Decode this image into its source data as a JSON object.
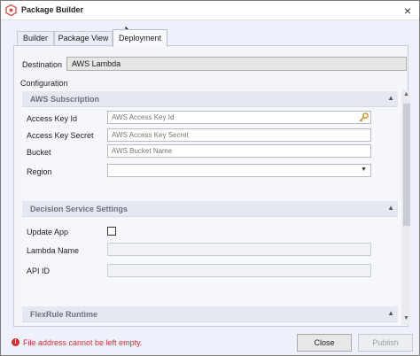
{
  "window": {
    "title": "Package Builder",
    "close_glyph": "×"
  },
  "tabs": [
    {
      "label": "Builder",
      "active": false
    },
    {
      "label": "Package View",
      "active": false
    },
    {
      "label": "Deployment",
      "active": true
    }
  ],
  "destination": {
    "label": "Destination",
    "value": "AWS Lambda",
    "chevron": "⌵"
  },
  "configuration": {
    "label": "Configuration",
    "sections": [
      {
        "title": "AWS Subscription",
        "fields": [
          {
            "label": "Access Key Id",
            "placeholder": "AWS Access Key Id"
          },
          {
            "label": "Access Key Secret",
            "placeholder": "AWS Access Key Secret"
          },
          {
            "label": "Bucket",
            "placeholder": "AWS Bucket Name"
          },
          {
            "label": "Region",
            "placeholder": ""
          }
        ]
      },
      {
        "title": "Decision Service Settings",
        "fields": [
          {
            "label": "Update App"
          },
          {
            "label": "Lambda Name"
          },
          {
            "label": "API ID"
          }
        ]
      },
      {
        "title": "FlexRule Runtime"
      }
    ],
    "collapse_glyph": "▲",
    "select_chevron": "▼"
  },
  "footer": {
    "error_text": "File address cannot be left empty.",
    "error_glyph": "!",
    "close_label": "Close",
    "publish_label": "Publish"
  },
  "colors": {
    "error": "#d0312d",
    "panel": "#f3f5fb",
    "window_bg": "#eef1fb"
  },
  "icons": [
    "app-logo-icon",
    "close-icon",
    "chevron-down-icon",
    "collapse-up-icon",
    "key-icon",
    "error-icon"
  ]
}
